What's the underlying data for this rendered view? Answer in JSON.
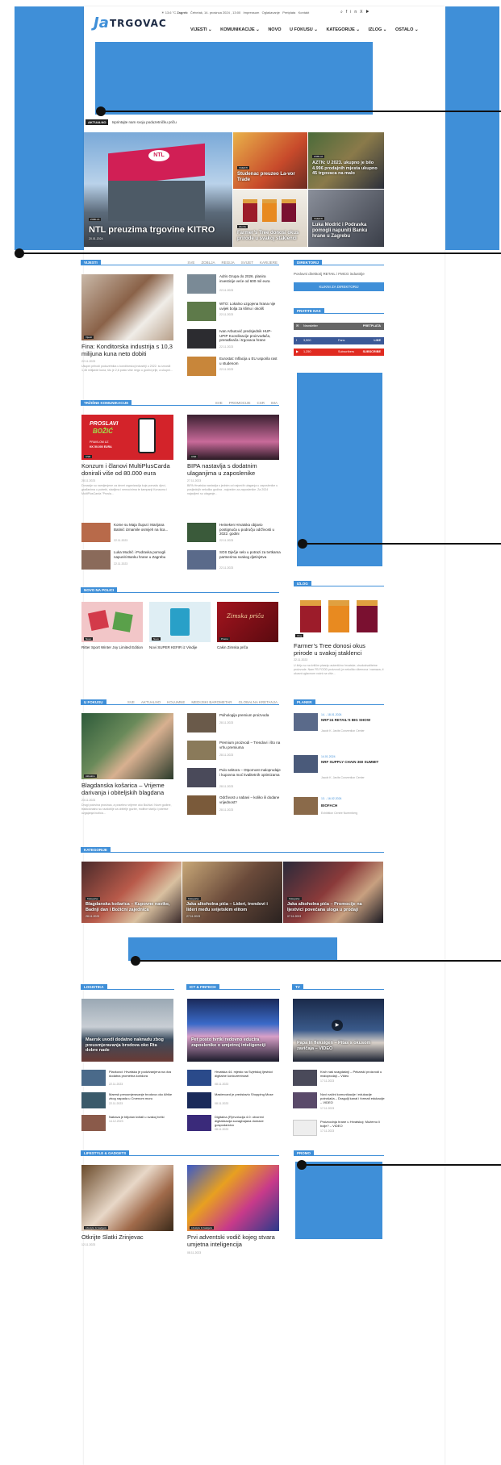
{
  "header": {
    "logo_mark": "Ja",
    "logo_word": "TRGOVAC",
    "weather": "13.6 °C",
    "city": "Zagreb",
    "date": "Četvrtak, 14. prosinca 2024 , 13:00",
    "links": [
      "Impressum",
      "Oglašavanje",
      "Pretplata",
      "Kontakt"
    ],
    "nav": [
      "VIJESTI ⌄",
      "KOMUNIKACIJE ⌄",
      "NOVO",
      "U FOKUSU ⌄",
      "KATEGORIJE ⌄",
      "IZLOG ⌄",
      "OSTALO ⌄"
    ]
  },
  "ticker": {
    "label": "AKTUALNO",
    "text": "Isprintajte nam svoju poduzetničku priču"
  },
  "hero": {
    "main": {
      "tag": "ZOBLJA",
      "title": "NTL preuzima trgovine KITRO",
      "date": "20.01.2024",
      "sign": "NTL"
    },
    "tiles": [
      {
        "tag": "VIJESTI",
        "title": "Studenac preuzeo La-vor Trade"
      },
      {
        "tag": "ZOBLJA",
        "title": "AZTN: U 2023. ukupno je bilo 4.996 prodajnih mjesta ukupno 45 trgovaca na malo"
      },
      {
        "tag": "IZLOG",
        "title": "Farmer’s Tree donosi okus prirode u svakoj staklenci"
      },
      {
        "tag": "VIJESTI",
        "title": "Luka Modrić i Podravka pomogli napuniti Banku hrane u Zagrebu"
      }
    ]
  },
  "vijesti": {
    "label": "VIJESTI",
    "tabs": [
      "SVE",
      "ZOBLJA",
      "REGIJA",
      "SVIJET",
      "KARIJERE"
    ],
    "lead": {
      "tag": "Vijesti",
      "title": "Fina: Konditorska industrija s 10,3 milijuna kuna neto dobiti",
      "date": "22.11.2023",
      "excerpt": "Ukupni prihodi poduzetnika u konditorskoj industriji u 2022. su iznosili 1,46 milijarde kuna, što je 2,6 posto više nego u godini prije, a ukupni..."
    },
    "items": [
      {
        "title": "Adris Grupa do 2026. planira investicije veće od 600 mil eura",
        "date": "22.11.2023"
      },
      {
        "title": "WTO: Lokalno uzgojena hrana nije uvijek bolja za klimu i okoliš",
        "date": "22.11.2023"
      },
      {
        "title": "Ivan Arbutović predsjednik HUP-UPIP Koordinacije proizvođača, prerađivača i trgovaca hrane",
        "date": "22.11.2023"
      },
      {
        "title": "Eurostat: Inflacija u EU usporila rast u studenom",
        "date": "22.11.2023"
      }
    ]
  },
  "direktorij": {
    "label": "DIREKTORIJ",
    "text": "Poslovni direktorij RETAIL i FMCG industrije",
    "button": "KLIKNI ZA DIREKTORIJ"
  },
  "pratite": {
    "label": "PRATITE NAS",
    "rows": [
      {
        "name": "Newsletter",
        "count": "",
        "action": "PRETPLATA",
        "color": "#666666"
      },
      {
        "name": "3,500",
        "count": "Fans",
        "action": "LIKE",
        "color": "#3b5998"
      },
      {
        "name": "1,250",
        "count": "Subscribers",
        "action": "SUBSCRIBE",
        "color": "#e02a20"
      }
    ]
  },
  "trzisne": {
    "label": "TRŽIŠNE KOMUNIKACIJE",
    "tabs": [
      "SVE",
      "PROMOCIJE",
      "CSR",
      "IMA"
    ],
    "leads": [
      {
        "tag": "CSR",
        "title": "Konzum i članovi MultiPlusCarda donirali više od 80.000 eura",
        "date": "28.11.2023",
        "excerpt": "Donacije su namijenjene za devet organizacija koje pomažu djeci, građanima u potrebi, starijima i nemoćnima te kampanji Konzuma i MultiPlusCarda \"Prosla..."
      },
      {
        "tag": "CSR",
        "title": "BIPA nastavlja s dodatnim ulaganjima u zaposlenike",
        "date": "27.11.2023",
        "excerpt": "BIPA Hrvatska nastavlja s jednim od najvećih ulaganja u zaposlenike u posljednjih nekoliko godina - najvećim za zaposlenike. Za 2024 najavljeni su ulaganje..."
      }
    ],
    "promo_image": {
      "line1": "PROSLAVI",
      "line2": "BOŽIĆ",
      "line3": "PRAVILOM UZ",
      "line4": "KK 50.000 EURA"
    },
    "items": [
      {
        "title": "Kome su Maja Šuput i Marijana Batinić izmamile osmijeh na lica...",
        "date": "22.11.2023"
      },
      {
        "title": "Luka Modrić i Podravka pomogli napuniti Banku hrane u Zagrebu",
        "date": "22.11.2023"
      },
      {
        "title": "Heineken Hrvatska objavio postignuća u području održivosti u 2022. godini",
        "date": "22.11.2023"
      },
      {
        "title": "SOS Dječje selo u potrazi za tvrtkama partnerima svakog djetinjstva",
        "date": "22.11.2023"
      }
    ]
  },
  "izlog": {
    "label": "IZLOG",
    "tag": "Izlog",
    "title": "Farmer’s Tree donosi okus prirode u svakoj staklenci",
    "date": "22.11.2023",
    "excerpt": "U žiriju su na krilčim pisanju autentično hrvatske, visokokvalitetne proizvode. Nam FB FOOD proizvodi, je nekoliko džemova i namaza, ti ukusni uglavnom voćni na više..."
  },
  "novo": {
    "label": "NOVO NA POLICI",
    "items": [
      {
        "tag": "Novo",
        "title": "Ritter Sport Winter Joy Limited Edition"
      },
      {
        "tag": "Novo",
        "title": "Novi SUPER KEFIR iz Vindije"
      },
      {
        "tag": "Promo",
        "title": "Cakin Zimska priča",
        "img_text": "Zimska priča"
      }
    ]
  },
  "fokus": {
    "label": "U FOKUSU",
    "tabs": [
      "SVE",
      "AKTUALNO",
      "KOLUMNE",
      "MEDIJSKI BAROMETAR",
      "GLOBALNA KRETANJA"
    ],
    "lead": {
      "tag": "Aktualno",
      "title": "Blagdanska košarica – Vrijeme darivanja i obiteljskih blagdana",
      "date": "23.11.2023",
      "excerpt": "Drugi polovina prosinca, a posebno vrijeme oko Božića i Nove godine, tradicionalno su razdoblje za obitelje gozbe, molitve stariju i potrese uzgajanja božića..."
    },
    "items": [
      {
        "title": "Psihologija premium proizvoda",
        "date": "28.11.2023"
      },
      {
        "title": "Premium proizvodi – Trendovi i što na vrhu premiuma",
        "date": "28.11.2023"
      },
      {
        "title": "Pulo sektora – Otpornost maloprodaje i kupovna moć kvalitetnih optimizama",
        "date": "28.11.2023"
      },
      {
        "title": "Održivost u nabavi – koliko ili dodane vrijednost?",
        "date": "28.11.2023"
      }
    ]
  },
  "planer": {
    "label": "PLANER",
    "events": [
      {
        "dates": "14. - 18.01.2024",
        "title": "NRF'24 RETAIL'S BIG SHOW",
        "place": "Jacob K. Javits Convention Center"
      },
      {
        "dates": "14.01.2024",
        "title": "NRF SUPPLY CHAIN 360 SUMMIT",
        "place": "Jacob K. Javits Convention Center"
      },
      {
        "dates": "13. - 16.02.2024",
        "title": "BIOFACH",
        "place": "Exhibition Centre Nuremberg"
      }
    ]
  },
  "kategorije": {
    "label": "KATEGORIJE",
    "items": [
      {
        "tag": "Kategorije",
        "title": "Blagdanska košarica – Kupovne navike, Badnji dan i Božićni zajednica",
        "date": "28.11.2023"
      },
      {
        "tag": "Kategorije",
        "title": "Jaka alkoholna pića – Lideri, trendovi i lideri među svijetskim elitom",
        "date": "27.11.2023"
      },
      {
        "tag": "Kategorije",
        "title": "Jaka alkoholna pića – Promocije na ljestvici povećana uloga u prodaji",
        "date": "07.11.2023"
      }
    ]
  },
  "logistika": {
    "label": "LOGISTIKA",
    "lead": {
      "title": "Maersk uvodi dodatno naknadu zbog preusmjeravanja brodova oko Rta dobre nade"
    },
    "items": [
      {
        "title": "Plavkovci: Hrvatska je podzivanjena na dva dodatna prometna koridora",
        "date": "22.11.2023"
      },
      {
        "title": "Maersk preusmjeravanje brodova oko Afrike zbog napada u Crvenom moru",
        "date": "22.11.2023"
      },
      {
        "title": "Nabava je bitjotan kvitall u svakoj tvrtki",
        "date": "14.12.2023"
      }
    ]
  },
  "ict": {
    "label": "ICT & FINTECH",
    "lead": {
      "title": "Pet posto tvrtki redovno educira zaposlenike o umjetnoj inteligenciji"
    },
    "items": [
      {
        "title": "Hrvatska 44. mjesto na Svjetskoj ljestvici digitalne konkurentnosti",
        "date": "08.11.2023"
      },
      {
        "title": "Mastercard je predstavio Shopping Muse",
        "date": "08.11.2023"
      },
      {
        "title": "Digitalna (R)evolucija 4.0: otvoreni digitalizacija suvagbajana domaće gospodarstvo",
        "date": "08.11.2023"
      }
    ]
  },
  "tv": {
    "label": "TV",
    "lead": {
      "title": "Papa in fleksigen – Pitas s okusom zavičaja – VIDEO"
    },
    "items": [
      {
        "title": "Kruh naš svagdašnji – Pekarski proizvodi u maloprodaji – Video",
        "date": "17.11.2023"
      },
      {
        "title": "Novi načini komunikacije i edukacije potrošača – Dragulji kanal i formati edukacije – VIDEO",
        "date": "17.11.2023"
      },
      {
        "title": "Proizvodnja hrane u Hrvatskoj: Možemo li bolje? – VIDEO",
        "date": "17.11.2023"
      }
    ]
  },
  "lifestyle": {
    "label": "LIFESTYLE & GADGETS",
    "items": [
      {
        "tag": "Lifestyle & Gadgets",
        "title": "Otkrijte Slatki Zrinjevac",
        "date": "12.11.2023"
      },
      {
        "tag": "Lifestyle & Gadgets",
        "title": "Prvi adventski vodič kojeg stvara umjetna inteligencija",
        "date": "08.11.2023"
      }
    ]
  },
  "promo": {
    "label": "PROMO"
  }
}
